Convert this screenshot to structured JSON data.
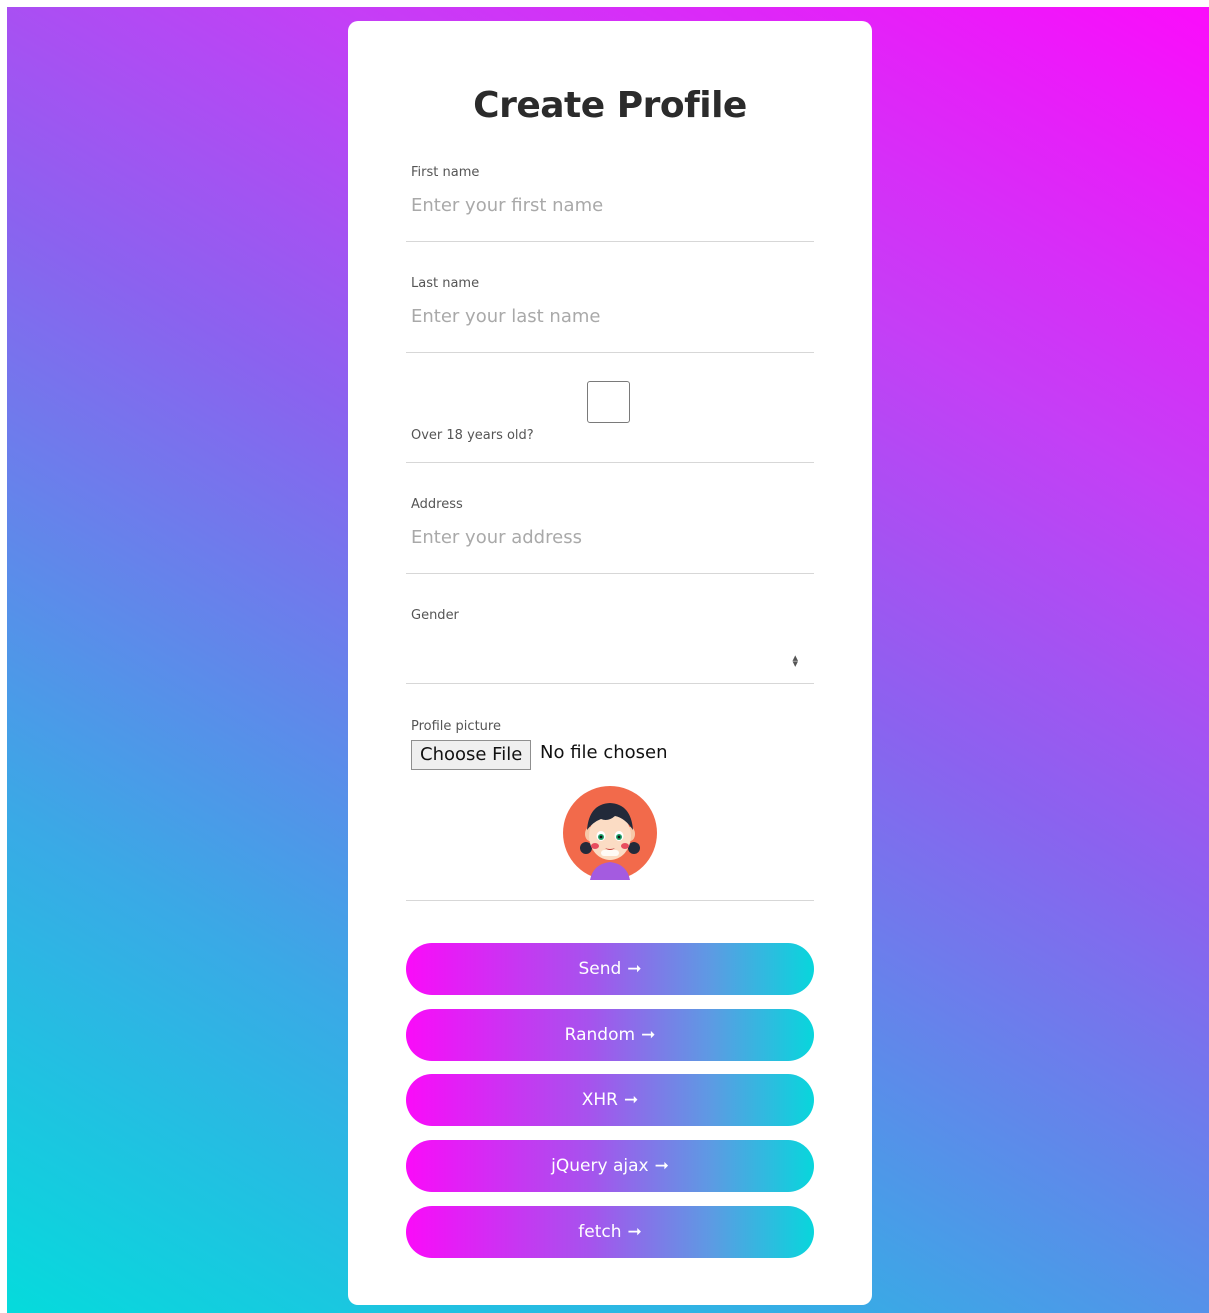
{
  "title": "Create Profile",
  "first_name": {
    "label": "First name",
    "placeholder": "Enter your first name"
  },
  "last_name": {
    "label": "Last name",
    "placeholder": "Enter your last name"
  },
  "over_18": {
    "label": "Over 18 years old?",
    "checked": false
  },
  "address": {
    "label": "Address",
    "placeholder": "Enter your address"
  },
  "gender": {
    "label": "Gender",
    "value": ""
  },
  "profile_picture": {
    "label": "Profile picture",
    "button_label": "Choose File",
    "status": "No file chosen"
  },
  "buttons": [
    {
      "label": "Send",
      "icon": "arrow-right-icon"
    },
    {
      "label": "Random",
      "icon": "arrow-right-icon"
    },
    {
      "label": "XHR",
      "icon": "arrow-right-icon"
    },
    {
      "label": "jQuery ajax",
      "icon": "arrow-right-icon"
    },
    {
      "label": "fetch",
      "icon": "arrow-right-icon"
    }
  ],
  "colors": {
    "gradient_start": "#fb0cfb",
    "gradient_end": "#05dbdc",
    "card_background": "#ffffff",
    "title_color": "#2b2b2b"
  }
}
